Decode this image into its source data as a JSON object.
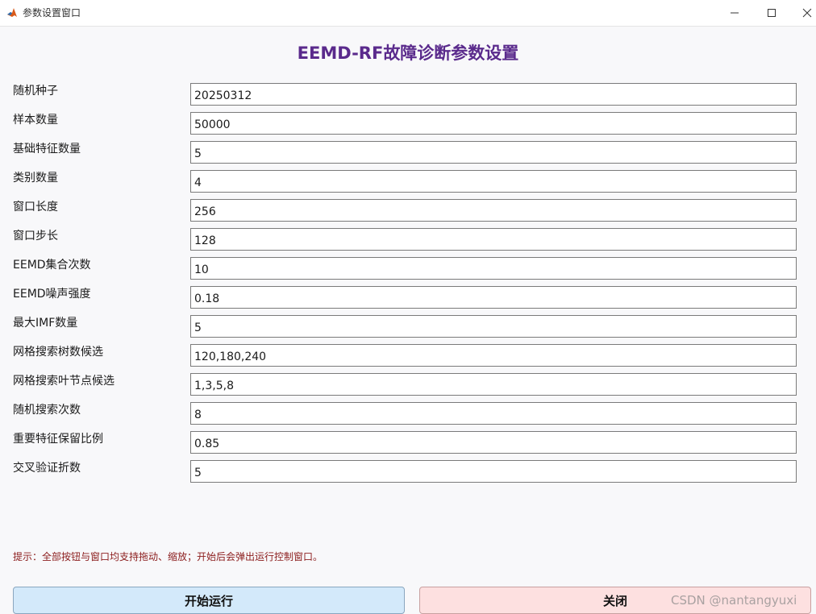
{
  "window": {
    "title": "参数设置窗口",
    "icon": "matlab-icon"
  },
  "heading": "EEMD-RF故障诊断参数设置",
  "params": [
    {
      "label": "随机种子",
      "value": "20250312"
    },
    {
      "label": "样本数量",
      "value": "50000"
    },
    {
      "label": "基础特征数量",
      "value": "5"
    },
    {
      "label": "类别数量",
      "value": "4"
    },
    {
      "label": "窗口长度",
      "value": "256"
    },
    {
      "label": "窗口步长",
      "value": "128"
    },
    {
      "label": "EEMD集合次数",
      "value": "10"
    },
    {
      "label": "EEMD噪声强度",
      "value": "0.18"
    },
    {
      "label": "最大IMF数量",
      "value": "5"
    },
    {
      "label": "网格搜索树数候选",
      "value": "120,180,240"
    },
    {
      "label": "网格搜索叶节点候选",
      "value": "1,3,5,8"
    },
    {
      "label": "随机搜索次数",
      "value": "8"
    },
    {
      "label": "重要特征保留比例",
      "value": "0.85"
    },
    {
      "label": "交叉验证折数",
      "value": "5"
    }
  ],
  "hint": "提示：全部按钮与窗口均支持拖动、缩放；开始后会弹出运行控制窗口。",
  "buttons": {
    "start": "开始运行",
    "close": "关闭"
  },
  "watermark": "CSDN @nantangyuxi",
  "colors": {
    "heading": "#5a2a8c",
    "hint": "#8b1c1c",
    "start_bg": "#d3e9fa",
    "close_bg": "#fde0e0"
  }
}
